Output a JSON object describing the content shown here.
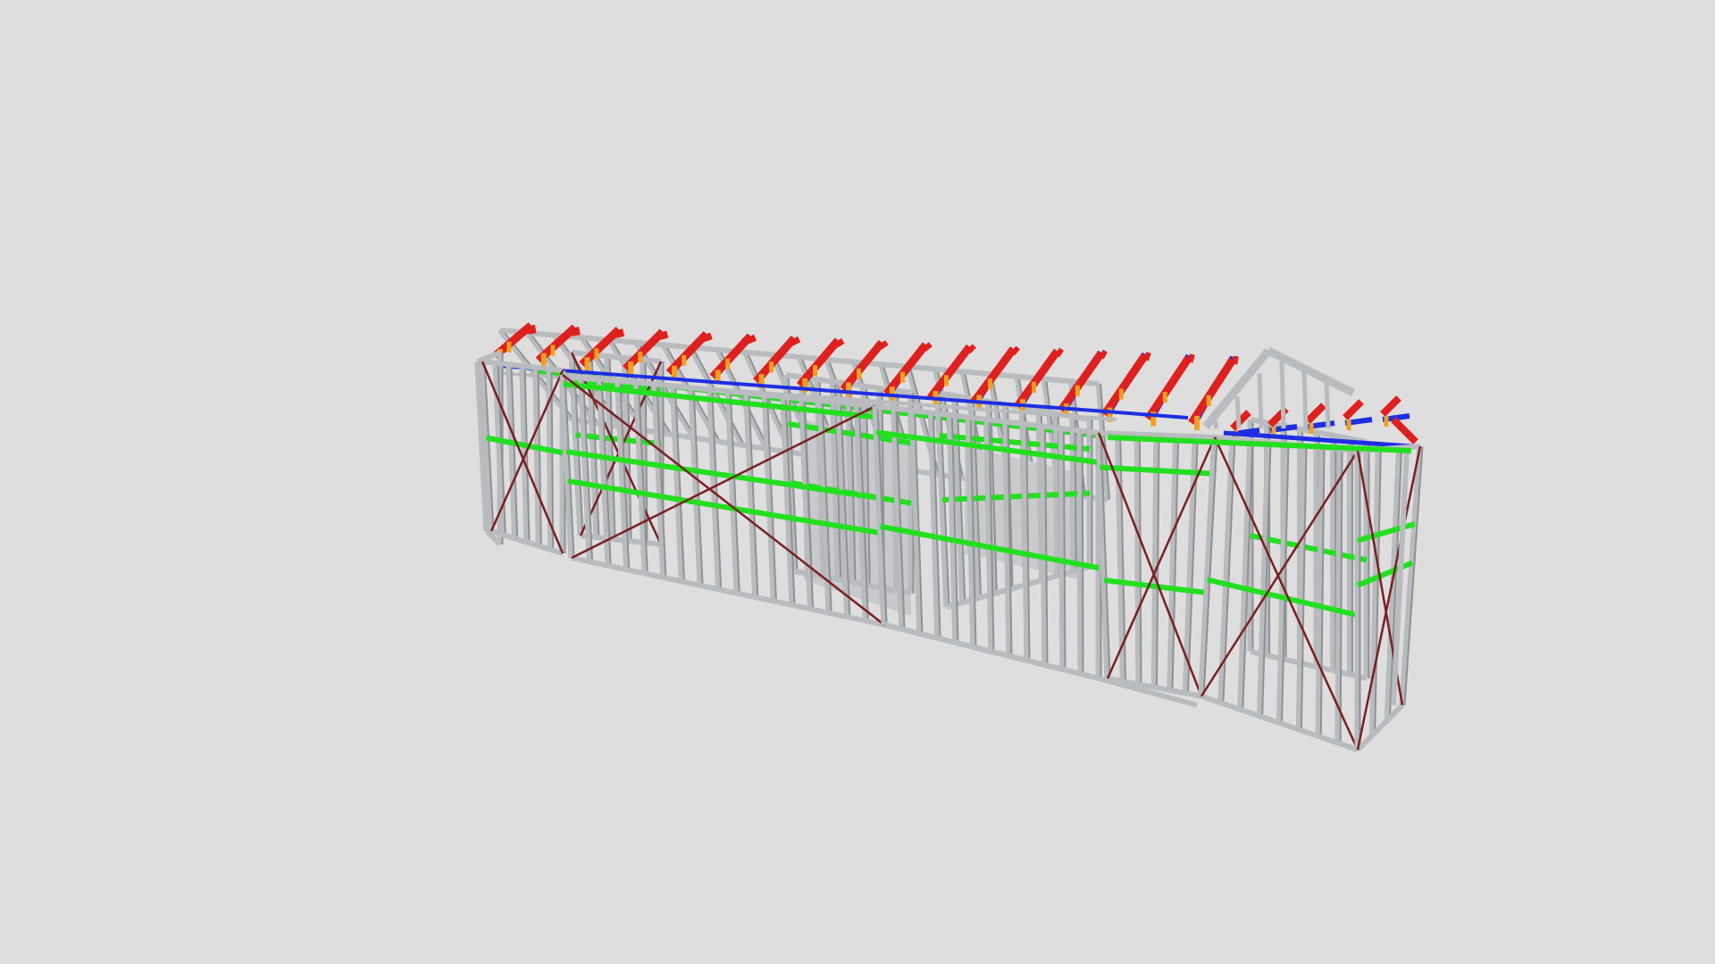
{
  "viewer": {
    "background_color": "#dedede"
  },
  "model": {
    "kind": "steel frame house model",
    "colors": {
      "wall_frame": "#b9bcbe",
      "wall_frame_shadow": "#8f9294",
      "nogging": "#22e01f",
      "strap_brace": "#7b1f1f",
      "truss_chord": "#e0201c",
      "truss_web": "#1d2fe0",
      "truss_connector": "#f2a020"
    },
    "truss_count": 17,
    "visible_walls": [
      {
        "id": "left-end-wall"
      },
      {
        "id": "front-wall-section-1"
      },
      {
        "id": "front-wall-section-2"
      },
      {
        "id": "internal-walls"
      },
      {
        "id": "gable-wing-wall"
      },
      {
        "id": "right-end-wall"
      }
    ]
  }
}
